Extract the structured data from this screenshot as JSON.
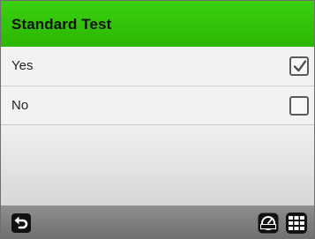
{
  "header": {
    "title": "Standard Test"
  },
  "options": [
    {
      "label": "Yes",
      "checked": true
    },
    {
      "label": "No",
      "checked": false
    }
  ],
  "footer": {
    "back_icon": "back-arrow-icon",
    "meter_icon": "meter-gauge-icon",
    "grid_icon": "keypad-grid-icon"
  },
  "colors": {
    "header": "#33c40a"
  }
}
